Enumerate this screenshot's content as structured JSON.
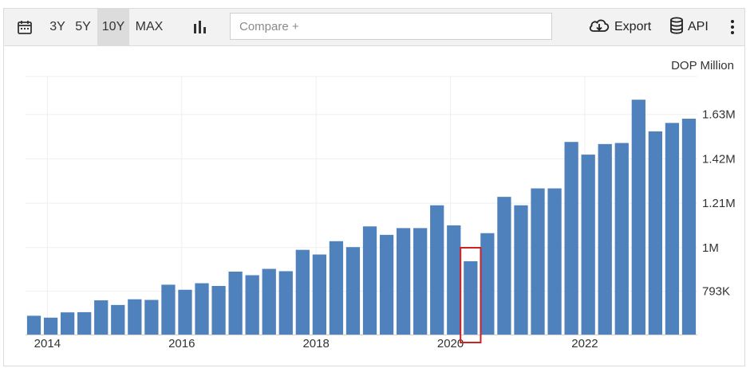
{
  "toolbar": {
    "calendar_icon": "calendar-icon",
    "ranges": [
      "3Y",
      "5Y",
      "10Y",
      "MAX"
    ],
    "active_range": "10Y",
    "chart_type_icon": "bar-chart-icon",
    "compare_placeholder": "Compare +",
    "export_label": "Export",
    "export_icon": "cloud-download-icon",
    "api_label": "API",
    "api_icon": "database-icon",
    "more_icon": "more-vertical-icon"
  },
  "colors": {
    "bar": "#4f81bd",
    "highlight_box": "#cc2222",
    "grid": "#efefef"
  },
  "chart_data": {
    "type": "bar",
    "unit_label": "DOP Million",
    "x_tick_labels": [
      "2014",
      "2016",
      "2018",
      "2020",
      "2022"
    ],
    "x_tick_years": [
      2014,
      2016,
      2018,
      2020,
      2022
    ],
    "quarters": [
      "2013Q4",
      "2014Q1",
      "2014Q2",
      "2014Q3",
      "2014Q4",
      "2015Q1",
      "2015Q2",
      "2015Q3",
      "2015Q4",
      "2016Q1",
      "2016Q2",
      "2016Q3",
      "2016Q4",
      "2017Q1",
      "2017Q2",
      "2017Q3",
      "2017Q4",
      "2018Q1",
      "2018Q2",
      "2018Q3",
      "2018Q4",
      "2019Q1",
      "2019Q2",
      "2019Q3",
      "2019Q4",
      "2020Q1",
      "2020Q2",
      "2020Q3",
      "2020Q4",
      "2021Q1",
      "2021Q2",
      "2021Q3",
      "2021Q4",
      "2022Q1",
      "2022Q2",
      "2022Q3",
      "2022Q4",
      "2023Q1",
      "2023Q2",
      "2023Q3"
    ],
    "values": [
      677000,
      668000,
      693000,
      694000,
      750000,
      728000,
      755000,
      752000,
      824000,
      800000,
      831000,
      818000,
      886000,
      869000,
      899000,
      888000,
      989000,
      967000,
      1030000,
      1002000,
      1100000,
      1060000,
      1092000,
      1092000,
      1200000,
      1105000,
      935000,
      1068000,
      1240000,
      1200000,
      1280000,
      1280000,
      1500000,
      1440000,
      1490000,
      1495000,
      1700000,
      1550000,
      1590000,
      1610000
    ],
    "y_ticks": [
      793000,
      1000000,
      1210000,
      1420000,
      1630000
    ],
    "y_tick_labels": [
      "793K",
      "1M",
      "1.21M",
      "1.42M",
      "1.63M"
    ],
    "ylim": [
      588000,
      1810000
    ],
    "y_axis_side": "right",
    "grid": true,
    "highlighted_index": 26
  }
}
